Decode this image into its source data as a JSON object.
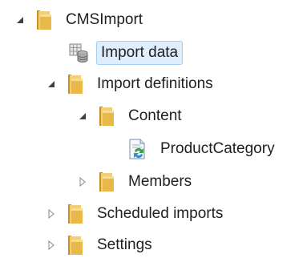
{
  "tree": {
    "nodes": [
      {
        "id": "root",
        "label": "CMSImport",
        "icon": "folder-icon",
        "toggle": "expanded",
        "selected": false
      },
      {
        "id": "import-data",
        "label": "Import data",
        "icon": "database-icon",
        "toggle": "none",
        "selected": true
      },
      {
        "id": "import-definitions",
        "label": "Import definitions",
        "icon": "folder-icon",
        "toggle": "expanded",
        "selected": false
      },
      {
        "id": "content",
        "label": "Content",
        "icon": "folder-icon",
        "toggle": "expanded",
        "selected": false
      },
      {
        "id": "productcategory",
        "label": "ProductCategory",
        "icon": "import-definition-icon",
        "toggle": "none",
        "selected": false
      },
      {
        "id": "members",
        "label": "Members",
        "icon": "folder-icon",
        "toggle": "collapsed",
        "selected": false
      },
      {
        "id": "scheduled-imports",
        "label": "Scheduled imports",
        "icon": "folder-icon",
        "toggle": "collapsed",
        "selected": false
      },
      {
        "id": "settings",
        "label": "Settings",
        "icon": "folder-icon",
        "toggle": "collapsed",
        "selected": false
      }
    ]
  },
  "colors": {
    "selection_bg": "#dfeefc",
    "selection_border": "#a6cdf2",
    "folder": "#e8b84a"
  }
}
